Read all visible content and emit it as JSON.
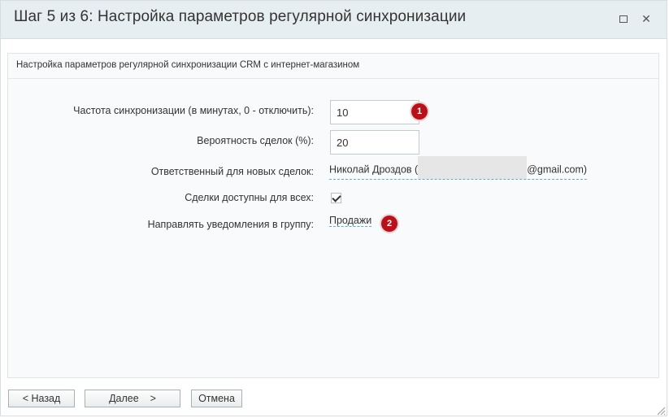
{
  "window": {
    "title": "Шаг 5 из 6: Настройка параметров регулярной синхронизации"
  },
  "panel": {
    "header": "Настройка параметров регулярной синхронизации CRM с интернет-магазином"
  },
  "form": {
    "sync_frequency_label": "Частота синхронизации (в минутах, 0 - отключить):",
    "sync_frequency_value": "10",
    "deal_probability_label": "Вероятность сделок (%):",
    "deal_probability_value": "20",
    "responsible_label": "Ответственный для новых сделок:",
    "responsible_value_prefix": "Николай Дроздов (",
    "responsible_value_suffix": "@gmail.com)",
    "deals_public_label": "Сделки доступны для всех:",
    "deals_public_checked": true,
    "notify_group_label": "Направлять уведомления в группу:",
    "notify_group_value": "Продажи"
  },
  "badges": {
    "first": "1",
    "second": "2"
  },
  "buttons": {
    "back": "< Назад",
    "next": "Далее    >",
    "cancel": "Отмена"
  },
  "colors": {
    "titlebar": "#e7eef1",
    "badge": "#b5121b"
  }
}
